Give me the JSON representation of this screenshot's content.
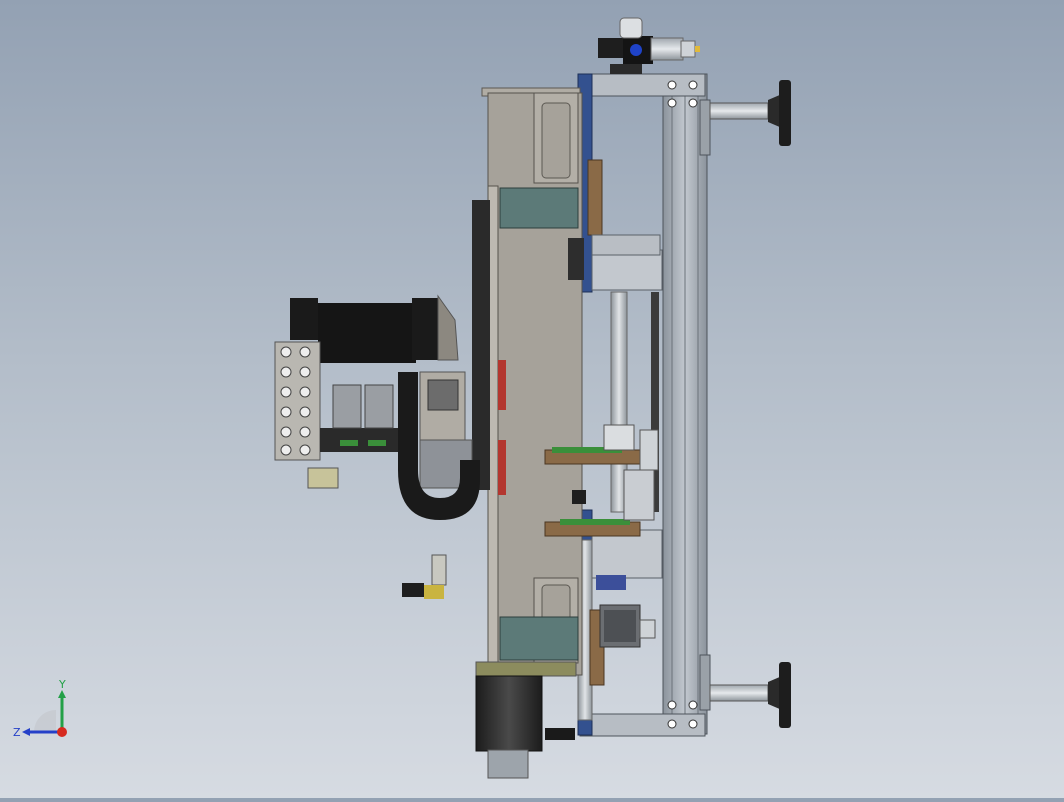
{
  "viewport": {
    "background_top": "#93a1b3",
    "background_bottom": "#d6dbe2",
    "model_colors": {
      "frame_gray": "#a6a29a",
      "extrusion": "#a9b0b8",
      "blue_plate": "#33518f",
      "teal_gusset": "#5c7a78",
      "dark_motor": "#2b2b2b",
      "brown_block": "#8a6a47",
      "red_marker": "#b3362f",
      "pcb_green": "#3a8f3a"
    }
  },
  "triad": {
    "x_axis_color": "#d62a1f",
    "y_label": "Y",
    "y_axis_color": "#23a047",
    "z_label": "Z",
    "z_axis_color": "#2540c8"
  }
}
